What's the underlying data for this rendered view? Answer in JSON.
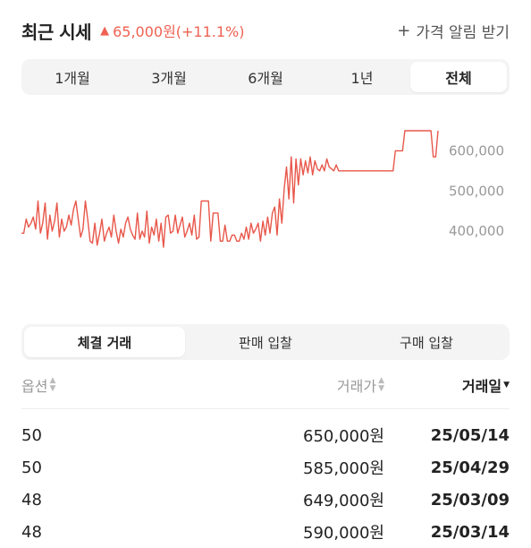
{
  "header": {
    "title": "최근 시세",
    "change_icon": "up-triangle",
    "change_text": "65,000원(+11.1%)",
    "alert_label": "가격 알림 받기",
    "accent_color": "#ef6253"
  },
  "period_tabs": [
    {
      "label": "1개월",
      "active": false
    },
    {
      "label": "3개월",
      "active": false
    },
    {
      "label": "6개월",
      "active": false
    },
    {
      "label": "1년",
      "active": false
    },
    {
      "label": "전체",
      "active": true
    }
  ],
  "chart_data": {
    "type": "line",
    "line_color": "#e8574a",
    "y_ticks": [
      "600,000",
      "500,000",
      "400,000"
    ],
    "ylim": [
      320000,
      650000
    ],
    "values": [
      395000,
      395000,
      430000,
      410000,
      420000,
      435000,
      405000,
      475000,
      395000,
      420000,
      470000,
      380000,
      440000,
      400000,
      425000,
      470000,
      385000,
      430000,
      400000,
      410000,
      440000,
      415000,
      455000,
      475000,
      430000,
      385000,
      405000,
      475000,
      430000,
      375000,
      370000,
      420000,
      365000,
      395000,
      430000,
      375000,
      395000,
      410000,
      385000,
      440000,
      400000,
      370000,
      405000,
      385000,
      420000,
      435000,
      405000,
      390000,
      380000,
      445000,
      380000,
      400000,
      385000,
      450000,
      370000,
      410000,
      390000,
      430000,
      375000,
      420000,
      360000,
      435000,
      440000,
      395000,
      400000,
      440000,
      395000,
      415000,
      435000,
      385000,
      400000,
      420000,
      390000,
      440000,
      380000,
      385000,
      475000,
      475000,
      475000,
      475000,
      375000,
      445000,
      445000,
      445000,
      375000,
      375000,
      415000,
      375000,
      375000,
      390000,
      390000,
      375000,
      375000,
      395000,
      380000,
      410000,
      380000,
      420000,
      395000,
      405000,
      420000,
      375000,
      425000,
      390000,
      435000,
      395000,
      445000,
      460000,
      390000,
      480000,
      420000,
      505000,
      560000,
      480000,
      585000,
      470000,
      580000,
      515000,
      580000,
      540000,
      575000,
      545000,
      585000,
      540000,
      575000,
      555000,
      550000,
      565000,
      550000,
      580000,
      560000,
      555000,
      550000,
      565000,
      550000,
      550000,
      550000,
      550000,
      550000,
      550000,
      550000,
      550000,
      550000,
      550000,
      550000,
      550000,
      550000,
      550000,
      550000,
      550000,
      550000,
      550000,
      550000,
      550000,
      550000,
      550000,
      550000,
      550000,
      600000,
      600000,
      600000,
      600000,
      650000,
      650000,
      650000,
      650000,
      650000,
      650000,
      650000,
      650000,
      650000,
      650000,
      650000,
      650000,
      585000,
      585000,
      650000
    ]
  },
  "trade_tabs": [
    {
      "label": "체결 거래",
      "active": true
    },
    {
      "label": "판매 입찰",
      "active": false
    },
    {
      "label": "구매 입찰",
      "active": false
    }
  ],
  "table": {
    "headers": {
      "option": "옵션",
      "price": "거래가",
      "date": "거래일"
    },
    "rows": [
      {
        "option": "50",
        "price": "650,000원",
        "date": "25/05/14"
      },
      {
        "option": "50",
        "price": "585,000원",
        "date": "25/04/29"
      },
      {
        "option": "48",
        "price": "649,000원",
        "date": "25/03/09"
      },
      {
        "option": "48",
        "price": "590,000원",
        "date": "25/03/14"
      }
    ]
  }
}
